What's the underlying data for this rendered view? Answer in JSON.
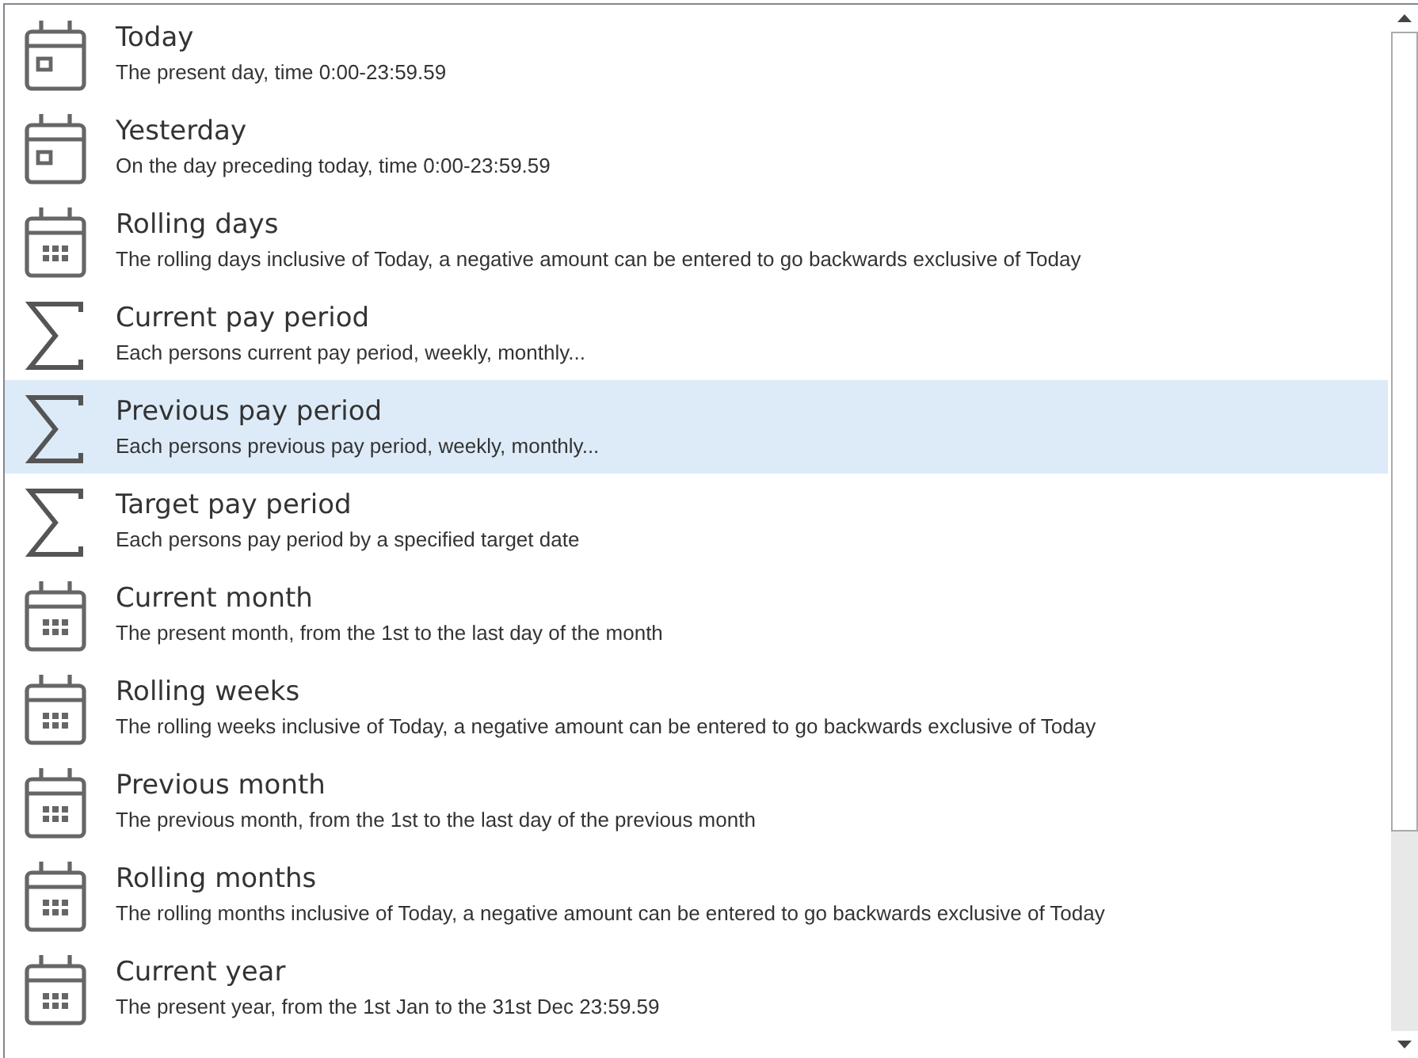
{
  "items": [
    {
      "kind": "day",
      "title": "Today",
      "description": "The present day, time 0:00-23:59.59",
      "selected": false
    },
    {
      "kind": "day",
      "title": "Yesterday",
      "description": "On the day preceding today, time 0:00-23:59.59",
      "selected": false
    },
    {
      "kind": "grid",
      "title": "Rolling days",
      "description": "The rolling days inclusive of Today, a negative amount can be entered to go backwards exclusive of Today",
      "selected": false
    },
    {
      "kind": "sum",
      "title": "Current pay period",
      "description": "Each persons current pay period, weekly, monthly...",
      "selected": false
    },
    {
      "kind": "sum",
      "title": "Previous pay period",
      "description": "Each persons previous pay period, weekly, monthly...",
      "selected": true
    },
    {
      "kind": "sum",
      "title": "Target pay period",
      "description": "Each persons pay period by a specified target date",
      "selected": false
    },
    {
      "kind": "grid",
      "title": "Current month",
      "description": "The present month, from the 1st to the last day of the month",
      "selected": false
    },
    {
      "kind": "grid",
      "title": "Rolling weeks",
      "description": "The rolling weeks inclusive of Today, a negative amount can be entered to go backwards exclusive of Today",
      "selected": false
    },
    {
      "kind": "grid",
      "title": "Previous month",
      "description": "The previous month, from the 1st to the last day of the previous month",
      "selected": false
    },
    {
      "kind": "grid",
      "title": "Rolling months",
      "description": "The rolling months inclusive of Today, a negative amount can be entered to go backwards exclusive of Today",
      "selected": false
    },
    {
      "kind": "grid",
      "title": "Current year",
      "description": "The present year, from the 1st Jan to the 31st Dec 23:59.59",
      "selected": false
    }
  ]
}
